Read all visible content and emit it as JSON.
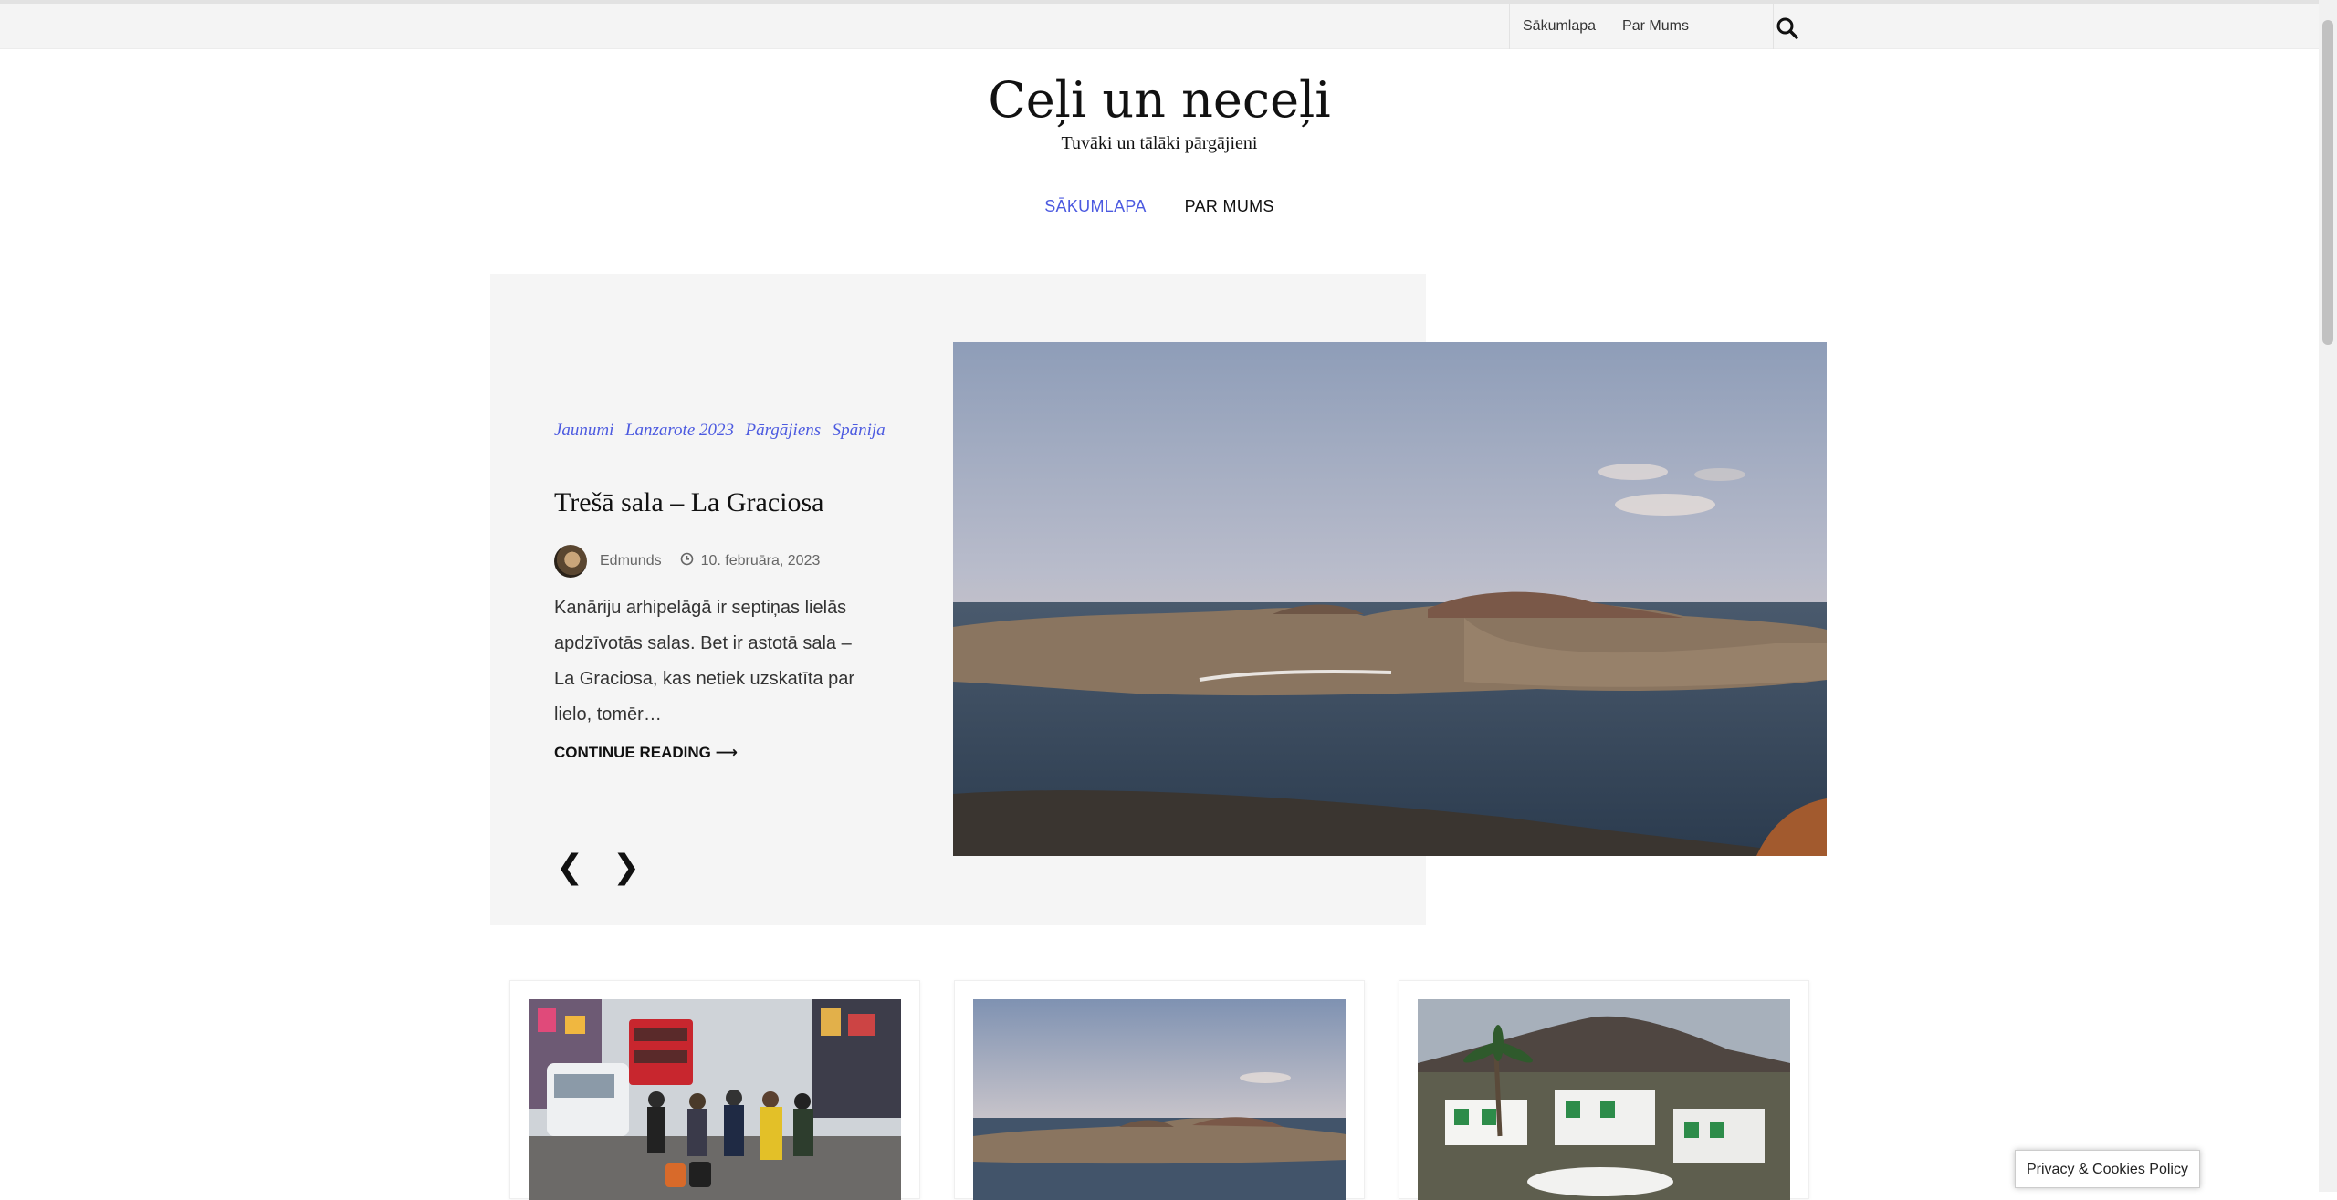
{
  "topbar": {
    "menu": [
      {
        "label": "Sākumlapa"
      },
      {
        "label": "Par Mums"
      }
    ],
    "search_icon": "search-icon"
  },
  "site": {
    "title": "Ceļi un neceļi",
    "tagline": "Tuvāki un tālāki pārgājieni"
  },
  "nav": {
    "items": [
      {
        "label": "SĀKUMLAPA",
        "active": true
      },
      {
        "label": "PAR MUMS",
        "active": false
      }
    ],
    "accent_color": "#4c5ae0"
  },
  "featured": {
    "categories": [
      "Jaunumi",
      "Lanzarote 2023",
      "Pārgājiens",
      "Spānija"
    ],
    "title": "Trešā sala – La Graciosa",
    "author": "Edmunds",
    "date": "10. februāra, 2023",
    "excerpt": "Kanāriju arhipelāgā ir septiņas lielās apdzīvotās salas. Bet ir astotā sala – La Graciosa, kas netiek uzskatīta par lielo, tomēr…",
    "continue_label": "CONTINUE READING ⟶",
    "prev_label": "❮",
    "next_label": "❯"
  },
  "cards": [
    {
      "image": "london-street-crowd"
    },
    {
      "image": "la-graciosa-island"
    },
    {
      "image": "lanzarote-white-houses"
    }
  ],
  "privacy": {
    "label": "Privacy & Cookies Policy"
  }
}
